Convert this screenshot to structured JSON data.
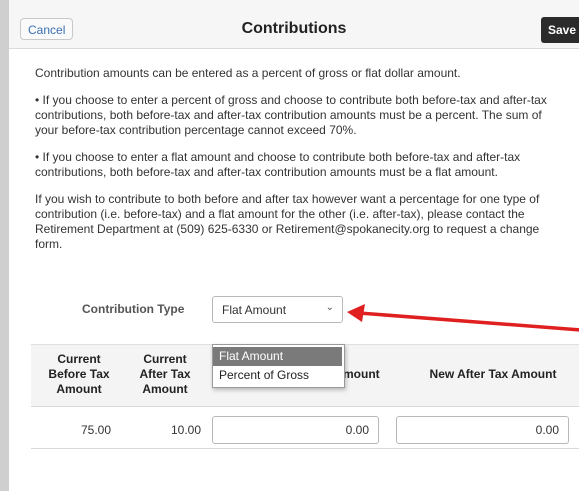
{
  "header": {
    "cancel_label": "Cancel",
    "title": "Contributions",
    "save_label": "Save"
  },
  "intro": {
    "p1": "Contribution amounts can be entered as a percent of gross or flat dollar amount.",
    "p2": "• If you choose to enter a percent of gross and choose to contribute both before-tax and after-tax contributions, both before-tax and after-tax contribution amounts must be a percent. The sum of your before-tax contribution percentage cannot exceed 70%.",
    "p3": "• If you choose to enter a flat amount and choose to contribute both before-tax and after-tax contributions, both before-tax and after-tax contribution amounts must be a flat amount.",
    "p4": "If you wish to contribute to both before and after tax however want a percentage for one type of contribution (i.e. before-tax) and a flat amount for the other (i.e. after-tax), please contact the Retirement Department at (509) 625-6330 or Retirement@spokanecity.org to request a change form."
  },
  "contribution_type": {
    "label": "Contribution Type",
    "selected": "Flat Amount",
    "options": [
      "Flat Amount",
      "Percent of Gross"
    ]
  },
  "table": {
    "headers": {
      "current_before": [
        "Current",
        "Before Tax",
        "Amount"
      ],
      "current_after": [
        "Current",
        "After Tax",
        "Amount"
      ],
      "new_before_partial": "Amount",
      "new_after": "New After Tax Amount"
    },
    "row": {
      "current_before": "75.00",
      "current_after": "10.00",
      "new_before": "0.00",
      "new_after": "0.00"
    }
  },
  "colors": {
    "arrow": "#e02020",
    "save_bg": "#2b2b2b",
    "selected_option_bg": "#7a7a7a"
  }
}
